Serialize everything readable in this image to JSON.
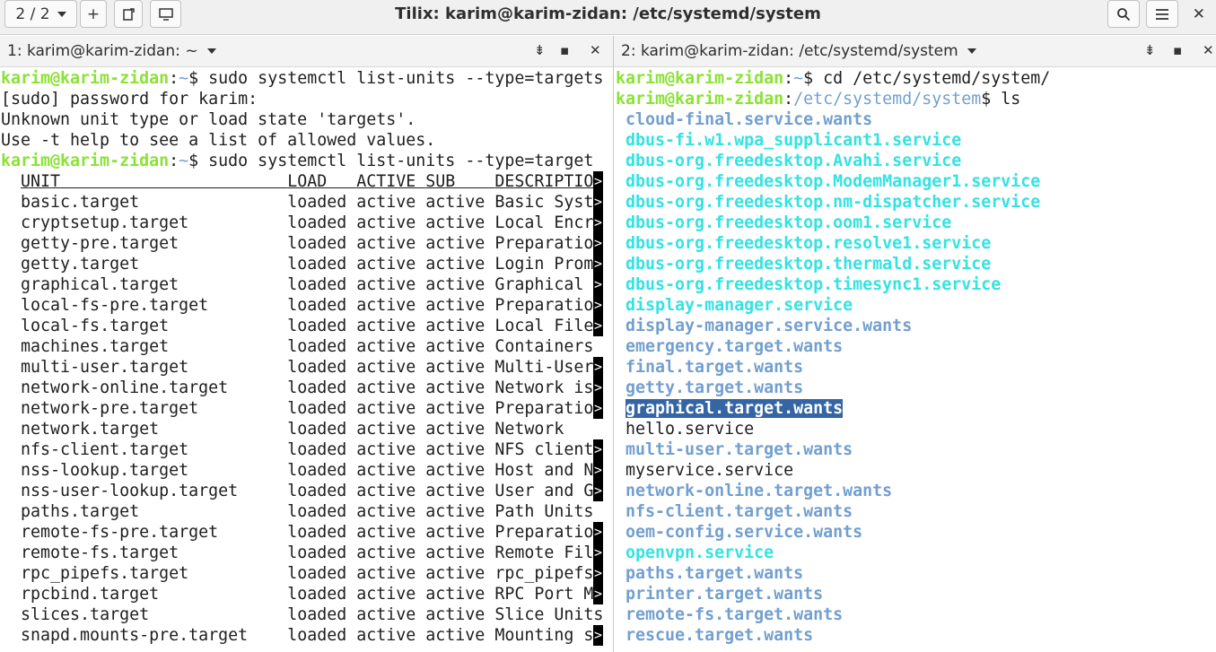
{
  "window": {
    "title": "Tilix: karim@karim-zidan: /etc/systemd/system",
    "session_label": "2 / 2"
  },
  "pane1": {
    "title": "1: karim@karim-zidan: ~",
    "prompt_user": "karim@karim-zidan",
    "prompt_path": "~",
    "lines": [
      {
        "kind": "cmd",
        "text": "$ sudo systemctl list-units --type=targets"
      },
      {
        "kind": "out",
        "text": "[sudo] password for karim:"
      },
      {
        "kind": "out",
        "text": "Unknown unit type or load state 'targets'."
      },
      {
        "kind": "out",
        "text": "Use -t help to see a list of allowed values."
      },
      {
        "kind": "cmd",
        "text": "$ sudo systemctl list-units --type=target"
      }
    ],
    "columns": [
      "UNIT",
      "LOAD",
      "ACTIVE",
      "SUB",
      "DESCRIPTIO"
    ],
    "units": [
      {
        "unit": "basic.target",
        "load": "loaded",
        "active": "active",
        "sub": "active",
        "desc": "Basic Syst",
        "trunc": true
      },
      {
        "unit": "cryptsetup.target",
        "load": "loaded",
        "active": "active",
        "sub": "active",
        "desc": "Local Encr",
        "trunc": true
      },
      {
        "unit": "getty-pre.target",
        "load": "loaded",
        "active": "active",
        "sub": "active",
        "desc": "Preparatio",
        "trunc": true
      },
      {
        "unit": "getty.target",
        "load": "loaded",
        "active": "active",
        "sub": "active",
        "desc": "Login Prom",
        "trunc": true
      },
      {
        "unit": "graphical.target",
        "load": "loaded",
        "active": "active",
        "sub": "active",
        "desc": "Graphical ",
        "trunc": true
      },
      {
        "unit": "local-fs-pre.target",
        "load": "loaded",
        "active": "active",
        "sub": "active",
        "desc": "Preparatio",
        "trunc": true
      },
      {
        "unit": "local-fs.target",
        "load": "loaded",
        "active": "active",
        "sub": "active",
        "desc": "Local File",
        "trunc": true
      },
      {
        "unit": "machines.target",
        "load": "loaded",
        "active": "active",
        "sub": "active",
        "desc": "Containers",
        "trunc": false
      },
      {
        "unit": "multi-user.target",
        "load": "loaded",
        "active": "active",
        "sub": "active",
        "desc": "Multi-User",
        "trunc": true
      },
      {
        "unit": "network-online.target",
        "load": "loaded",
        "active": "active",
        "sub": "active",
        "desc": "Network is",
        "trunc": true
      },
      {
        "unit": "network-pre.target",
        "load": "loaded",
        "active": "active",
        "sub": "active",
        "desc": "Preparatio",
        "trunc": true
      },
      {
        "unit": "network.target",
        "load": "loaded",
        "active": "active",
        "sub": "active",
        "desc": "Network",
        "trunc": false
      },
      {
        "unit": "nfs-client.target",
        "load": "loaded",
        "active": "active",
        "sub": "active",
        "desc": "NFS client",
        "trunc": true
      },
      {
        "unit": "nss-lookup.target",
        "load": "loaded",
        "active": "active",
        "sub": "active",
        "desc": "Host and N",
        "trunc": true
      },
      {
        "unit": "nss-user-lookup.target",
        "load": "loaded",
        "active": "active",
        "sub": "active",
        "desc": "User and G",
        "trunc": true
      },
      {
        "unit": "paths.target",
        "load": "loaded",
        "active": "active",
        "sub": "active",
        "desc": "Path Units",
        "trunc": false
      },
      {
        "unit": "remote-fs-pre.target",
        "load": "loaded",
        "active": "active",
        "sub": "active",
        "desc": "Preparatio",
        "trunc": true
      },
      {
        "unit": "remote-fs.target",
        "load": "loaded",
        "active": "active",
        "sub": "active",
        "desc": "Remote Fil",
        "trunc": true
      },
      {
        "unit": "rpc_pipefs.target",
        "load": "loaded",
        "active": "active",
        "sub": "active",
        "desc": "rpc_pipefs",
        "trunc": true
      },
      {
        "unit": "rpcbind.target",
        "load": "loaded",
        "active": "active",
        "sub": "active",
        "desc": "RPC Port M",
        "trunc": true
      },
      {
        "unit": "slices.target",
        "load": "loaded",
        "active": "active",
        "sub": "active",
        "desc": "Slice Units",
        "trunc": false
      },
      {
        "unit": "snapd.mounts-pre.target",
        "load": "loaded",
        "active": "active",
        "sub": "active",
        "desc": "Mounting s",
        "trunc": true
      }
    ],
    "overflow_marker": ">"
  },
  "pane2": {
    "title": "2: karim@karim-zidan: /etc/systemd/system",
    "prompt_user": "karim@karim-zidan",
    "lines": [
      {
        "path": "~",
        "cmd": "$ cd /etc/systemd/system/"
      },
      {
        "path": "/etc/systemd/system",
        "cmd": "$ ls"
      }
    ],
    "entries": [
      {
        "name": "cloud-final.service.wants",
        "kind": "dir"
      },
      {
        "name": "dbus-fi.w1.wpa_supplicant1.service",
        "kind": "link"
      },
      {
        "name": "dbus-org.freedesktop.Avahi.service",
        "kind": "link"
      },
      {
        "name": "dbus-org.freedesktop.ModemManager1.service",
        "kind": "link"
      },
      {
        "name": "dbus-org.freedesktop.nm-dispatcher.service",
        "kind": "link"
      },
      {
        "name": "dbus-org.freedesktop.oom1.service",
        "kind": "link"
      },
      {
        "name": "dbus-org.freedesktop.resolve1.service",
        "kind": "link"
      },
      {
        "name": "dbus-org.freedesktop.thermald.service",
        "kind": "link"
      },
      {
        "name": "dbus-org.freedesktop.timesync1.service",
        "kind": "link"
      },
      {
        "name": "display-manager.service",
        "kind": "link"
      },
      {
        "name": "display-manager.service.wants",
        "kind": "dir"
      },
      {
        "name": "emergency.target.wants",
        "kind": "dir"
      },
      {
        "name": "final.target.wants",
        "kind": "dir"
      },
      {
        "name": "getty.target.wants",
        "kind": "dir"
      },
      {
        "name": "graphical.target.wants",
        "kind": "dir",
        "selected": true
      },
      {
        "name": "hello.service",
        "kind": "file"
      },
      {
        "name": "multi-user.target.wants",
        "kind": "dir"
      },
      {
        "name": "myservice.service",
        "kind": "file"
      },
      {
        "name": "network-online.target.wants",
        "kind": "dir"
      },
      {
        "name": "nfs-client.target.wants",
        "kind": "dir"
      },
      {
        "name": "oem-config.service.wants",
        "kind": "dir"
      },
      {
        "name": "openvpn.service",
        "kind": "link"
      },
      {
        "name": "paths.target.wants",
        "kind": "dir"
      },
      {
        "name": "printer.target.wants",
        "kind": "dir"
      },
      {
        "name": "remote-fs.target.wants",
        "kind": "dir"
      },
      {
        "name": "rescue.target.wants",
        "kind": "dir"
      }
    ]
  },
  "colors": {
    "prompt_user": "#8ae234",
    "prompt_path": "#729fcf",
    "directory": "#729fcf",
    "symlink": "#34e2e2",
    "selection": "#3465a4"
  },
  "icons": {
    "session_menu": "chevron-down-icon",
    "add_terminal": "plus-icon",
    "new_session": "add-session-icon",
    "sidebar": "sidebar-icon",
    "search": "search-icon",
    "menu": "hamburger-menu-icon",
    "close": "close-icon",
    "pane_title_menu": "chevron-down-icon",
    "read_only": "lock-icon",
    "maximize": "maximize-icon"
  }
}
